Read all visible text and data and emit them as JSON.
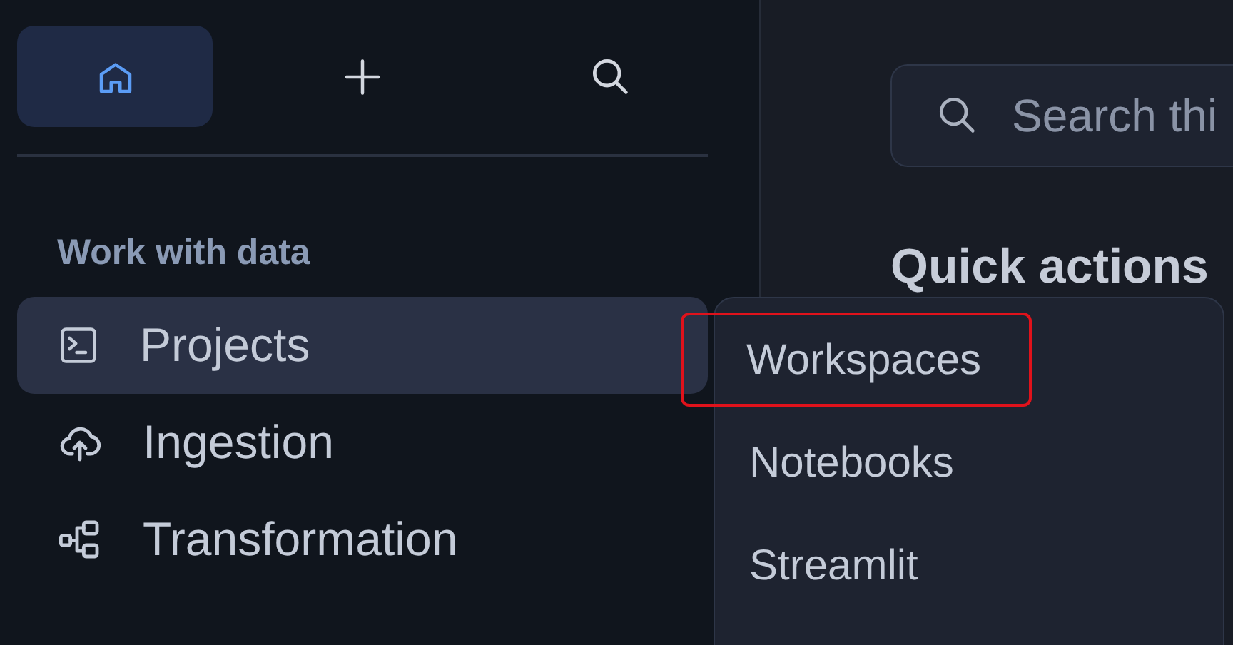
{
  "sidebar": {
    "top_buttons": [
      {
        "kind": "home",
        "selected": true
      },
      {
        "kind": "add",
        "selected": false
      },
      {
        "kind": "search",
        "selected": false
      }
    ],
    "section_title": "Work with data",
    "items": [
      {
        "label": "Projects",
        "kind": "terminal",
        "selected": true
      },
      {
        "label": "Ingestion",
        "kind": "cloud-upload",
        "selected": false
      },
      {
        "label": "Transformation",
        "kind": "flow",
        "selected": false
      }
    ]
  },
  "main": {
    "search": {
      "placeholder": "Search thi"
    },
    "heading": "Quick actions"
  },
  "menu": {
    "items": [
      {
        "label": "Workspaces",
        "highlighted": true
      },
      {
        "label": "Notebooks",
        "highlighted": false
      },
      {
        "label": "Streamlit",
        "highlighted": false
      }
    ]
  }
}
